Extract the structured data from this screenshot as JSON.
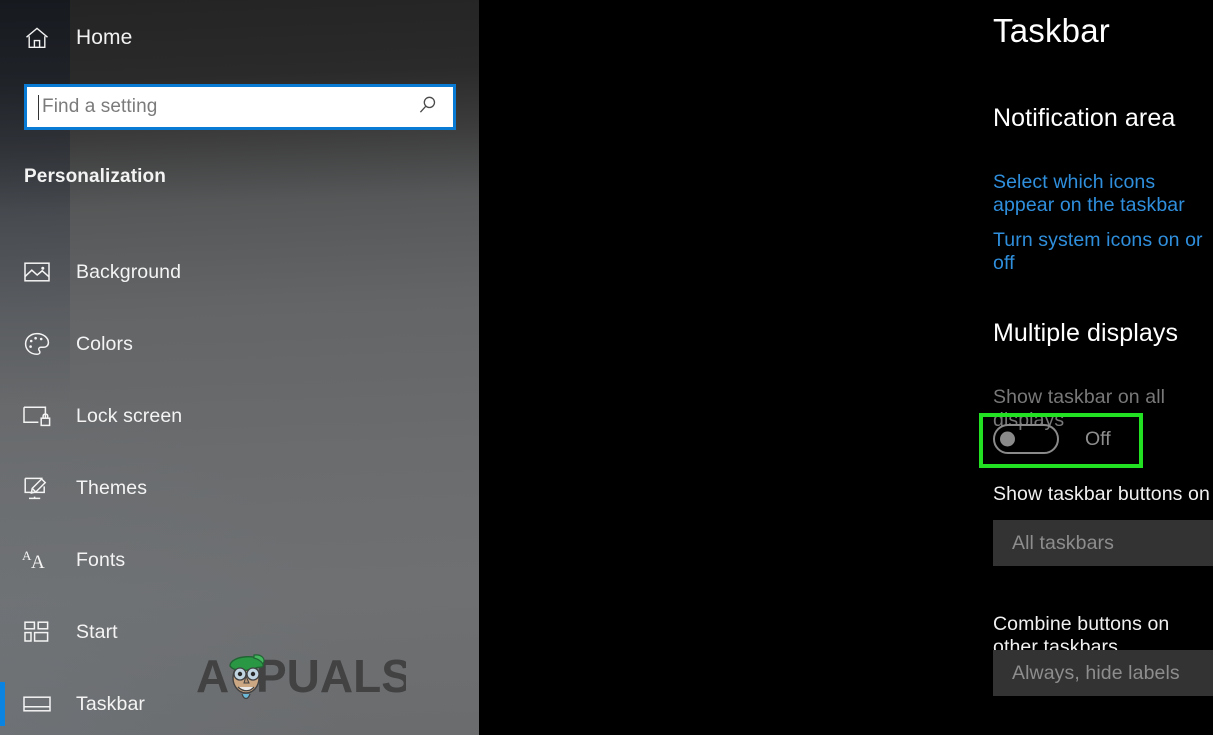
{
  "sidebar": {
    "home": {
      "label": "Home",
      "icon": "home-icon"
    },
    "search": {
      "value": "",
      "placeholder": "Find a setting",
      "icon": "search-icon"
    },
    "category_title": "Personalization",
    "items": [
      {
        "label": "Background",
        "icon": "picture-icon",
        "selected": false
      },
      {
        "label": "Colors",
        "icon": "palette-icon",
        "selected": false
      },
      {
        "label": "Lock screen",
        "icon": "lock-screen-icon",
        "selected": false
      },
      {
        "label": "Themes",
        "icon": "themes-brush-icon",
        "selected": false
      },
      {
        "label": "Fonts",
        "icon": "fonts-aa-icon",
        "selected": false
      },
      {
        "label": "Start",
        "icon": "start-tiles-icon",
        "selected": false
      },
      {
        "label": "Taskbar",
        "icon": "taskbar-icon",
        "selected": true
      }
    ],
    "watermark": "APPUALS"
  },
  "main": {
    "page_title": "Taskbar",
    "notification_area": {
      "heading": "Notification area",
      "links": [
        "Select which icons appear on the taskbar",
        "Turn system icons on or off"
      ]
    },
    "multiple_displays": {
      "heading": "Multiple displays",
      "show_taskbar_all_displays": {
        "label": "Show taskbar on all displays",
        "state": "Off",
        "checked": false,
        "highlighted": true
      },
      "show_taskbar_buttons_on": {
        "label": "Show taskbar buttons on",
        "value": "All taskbars",
        "chevron": "chevron-down-icon"
      },
      "combine_buttons": {
        "label": "Combine buttons on other taskbars",
        "value": "Always, hide labels",
        "chevron": "chevron-down-icon"
      }
    }
  },
  "colors": {
    "accent_blue": "#0a7bd4",
    "link_blue": "#2f8fdd",
    "highlight_green": "#22e022",
    "selection_blue": "#0a84e0",
    "main_bg": "#000000",
    "dropdown_bg": "#333333"
  }
}
